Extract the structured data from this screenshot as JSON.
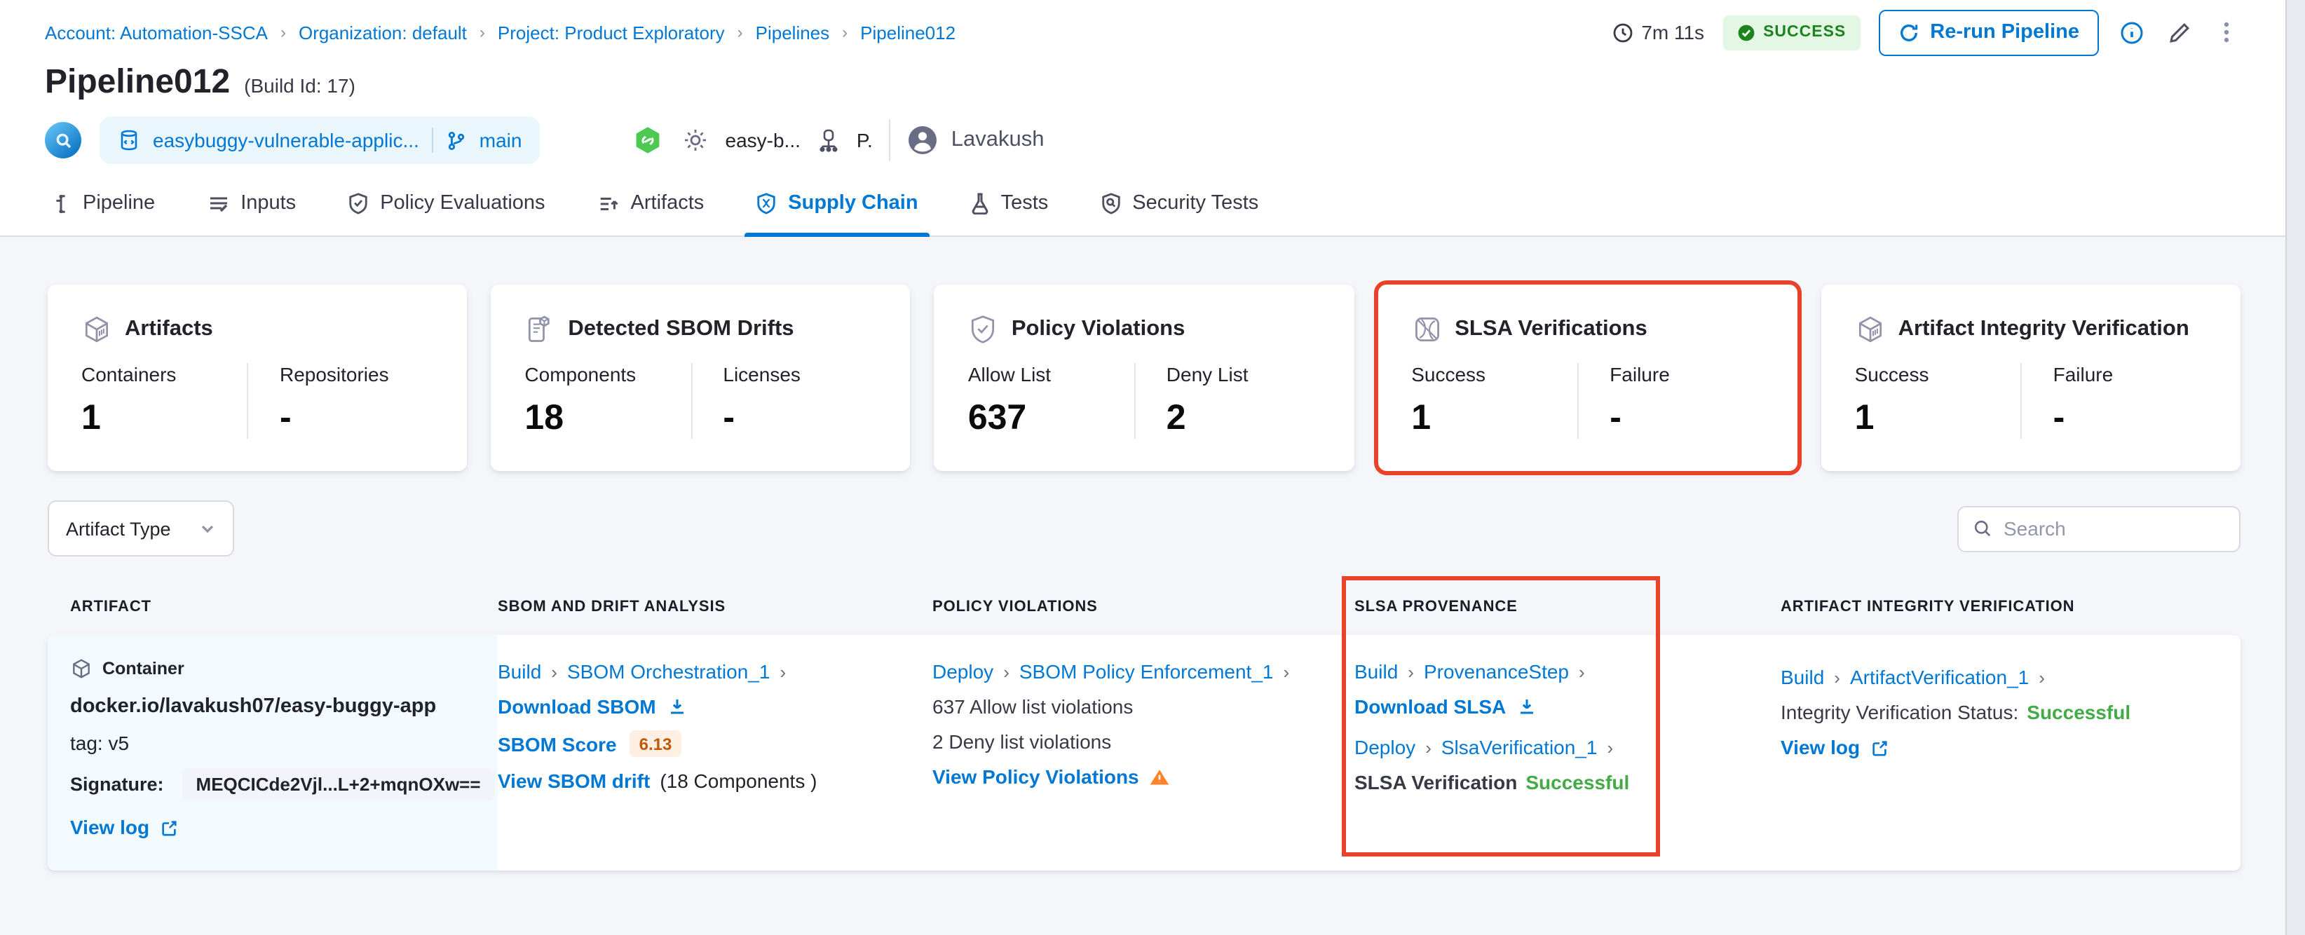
{
  "colors": {
    "accent_blue": "#0278d5",
    "success_green": "#42ab45",
    "badge_green_bg": "#e4f7e4",
    "annotation_red": "#e8432a",
    "warning_orange": "#ff832b",
    "score_orange": "#c05a0a"
  },
  "breadcrumb": {
    "items": [
      "Account: Automation-SSCA",
      "Organization: default",
      "Project: Product Exploratory",
      "Pipelines",
      "Pipeline012"
    ]
  },
  "header": {
    "title": "Pipeline012",
    "build_id": "(Build Id: 17)",
    "duration": "7m 11s",
    "status": "SUCCESS",
    "rerun_label": "Re-run Pipeline",
    "repo": {
      "name": "easybuggy-vulnerable-applic...",
      "branch": "main"
    },
    "meta": {
      "trigger": "easy-b...",
      "delegate": "P.",
      "user": "Lavakush"
    }
  },
  "tabs": [
    {
      "label": "Pipeline"
    },
    {
      "label": "Inputs"
    },
    {
      "label": "Policy Evaluations"
    },
    {
      "label": "Artifacts"
    },
    {
      "label": "Supply Chain"
    },
    {
      "label": "Tests"
    },
    {
      "label": "Security Tests"
    }
  ],
  "summary_cards": [
    {
      "title": "Artifacts",
      "metrics": [
        {
          "label": "Containers",
          "value": "1"
        },
        {
          "label": "Repositories",
          "value": "-"
        }
      ]
    },
    {
      "title": "Detected SBOM Drifts",
      "metrics": [
        {
          "label": "Components",
          "value": "18"
        },
        {
          "label": "Licenses",
          "value": "-"
        }
      ]
    },
    {
      "title": "Policy Violations",
      "metrics": [
        {
          "label": "Allow List",
          "value": "637"
        },
        {
          "label": "Deny List",
          "value": "2"
        }
      ]
    },
    {
      "title": "SLSA Verifications",
      "highlighted": true,
      "metrics": [
        {
          "label": "Success",
          "value": "1"
        },
        {
          "label": "Failure",
          "value": "-"
        }
      ]
    },
    {
      "title": "Artifact Integrity Verification",
      "metrics": [
        {
          "label": "Success",
          "value": "1"
        },
        {
          "label": "Failure",
          "value": "-"
        }
      ]
    }
  ],
  "filters": {
    "artifact_type_label": "Artifact Type",
    "search_placeholder": "Search"
  },
  "table": {
    "columns": [
      "ARTIFACT",
      "SBOM AND DRIFT ANALYSIS",
      "POLICY VIOLATIONS",
      "SLSA PROVENANCE",
      "ARTIFACT INTEGRITY VERIFICATION"
    ],
    "row": {
      "artifact": {
        "type_label": "Container",
        "name": "docker.io/lavakush07/easy-buggy-app",
        "tag": "tag: v5",
        "signature_label": "Signature:",
        "signature_value": "MEQCICde2Vjl...L+2+mqnOXw==",
        "view_log": "View log"
      },
      "sbom": {
        "stage": "Build",
        "step": "SBOM Orchestration_1",
        "download": "Download SBOM",
        "score_label": "SBOM Score",
        "score": "6.13",
        "drift_link": "View SBOM drift",
        "drift_suffix": "(18 Components )"
      },
      "policy": {
        "stage": "Deploy",
        "step": "SBOM Policy Enforcement_1",
        "allow": "637 Allow list violations",
        "deny": "2 Deny list violations",
        "view": "View Policy Violations"
      },
      "slsa": {
        "stage1": "Build",
        "step1": "ProvenanceStep",
        "download": "Download SLSA",
        "stage2": "Deploy",
        "step2": "SlsaVerification_1",
        "status_label": "SLSA Verification",
        "status_value": "Successful"
      },
      "integrity": {
        "stage": "Build",
        "step": "ArtifactVerification_1",
        "status_label": "Integrity Verification Status:",
        "status_value": "Successful",
        "view_log": "View log"
      }
    }
  }
}
